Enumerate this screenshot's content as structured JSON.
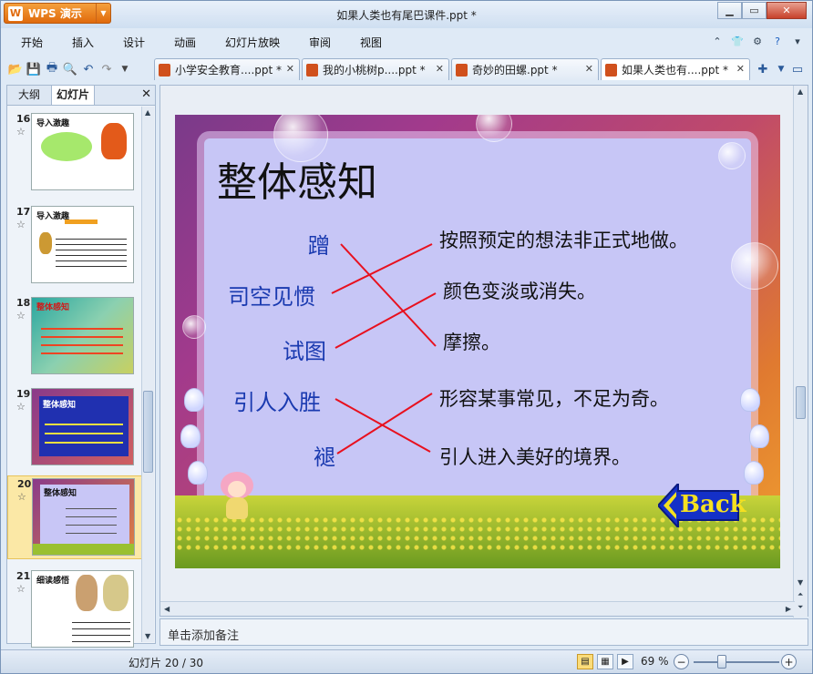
{
  "app": {
    "name": "WPS 演示",
    "window_title": "如果人类也有尾巴课件.ppt *"
  },
  "menu": [
    "开始",
    "插入",
    "设计",
    "动画",
    "幻灯片放映",
    "审阅",
    "视图"
  ],
  "tabs": [
    {
      "label": "小学安全教育....ppt *"
    },
    {
      "label": "我的小桃树p....ppt *"
    },
    {
      "label": "奇妙的田螺.ppt *"
    },
    {
      "label": "如果人类也有....ppt *"
    }
  ],
  "left_panel": {
    "tab_outline": "大纲",
    "tab_slides": "幻灯片",
    "slides": [
      {
        "number": "16",
        "title": "导入激趣",
        "star": "☆"
      },
      {
        "number": "17",
        "title": "导入激趣",
        "star": "☆"
      },
      {
        "number": "18",
        "title": "整体感知",
        "star": "☆"
      },
      {
        "number": "19",
        "title": "整体感知",
        "star": "☆"
      },
      {
        "number": "20",
        "title": "整体感知",
        "star": "☆"
      },
      {
        "number": "21",
        "title": "细读感悟",
        "star": "☆"
      }
    ]
  },
  "slide": {
    "title": "整体感知",
    "terms": [
      "蹭",
      "司空见惯",
      "试图",
      "引人入胜",
      "褪"
    ],
    "definitions": [
      "按照预定的想法非正式地做。",
      "颜色变淡或消失。",
      "摩擦。",
      "形容某事常见，不足为奇。",
      "引人进入美好的境界。"
    ],
    "back_button": "Back",
    "line_color": "#e8101e"
  },
  "notes_placeholder": "单击添加备注",
  "status": {
    "slide_indicator": "幻灯片 20 / 30",
    "zoom": "69 %"
  }
}
